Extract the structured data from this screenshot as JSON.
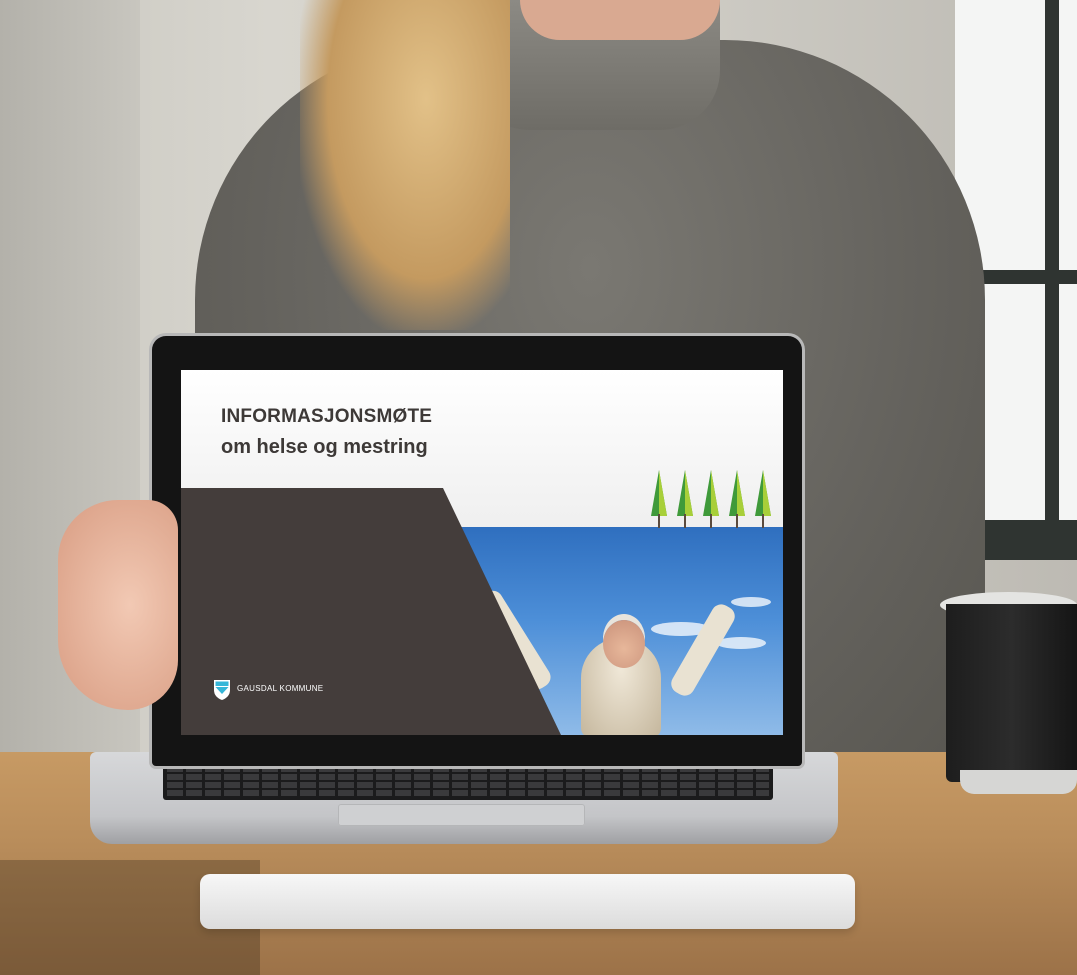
{
  "slide": {
    "title": "INFORMASJONSMØTE",
    "subtitle": "om helse og mestring",
    "logo_text": "GAUSDAL KOMMUNE",
    "colors": {
      "dark_panel": "#443d3b",
      "title_text": "#3d3937",
      "tree_dark": "#3f9a3a",
      "tree_light": "#a8cf39",
      "logo_shield_blue": "#35b6d8"
    },
    "icons": [
      "tree-icon",
      "gausdal-shield-icon"
    ]
  }
}
